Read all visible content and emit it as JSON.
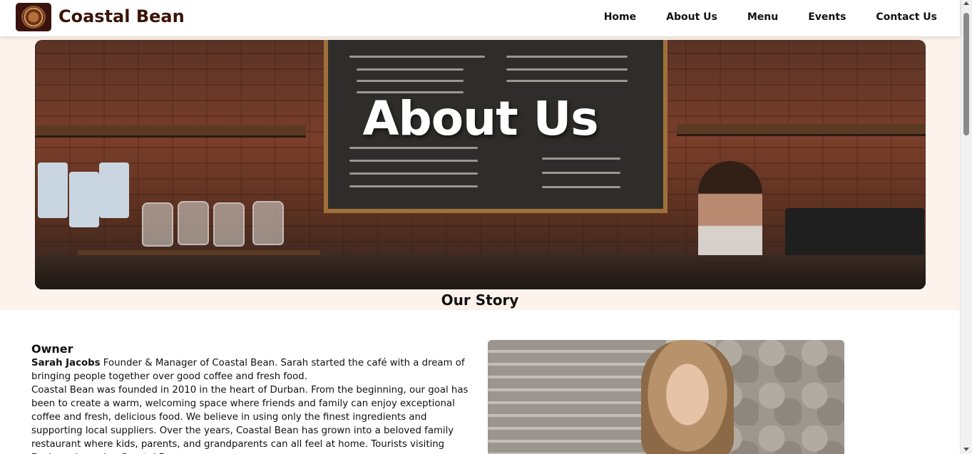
{
  "header": {
    "brand": "Coastal Bean",
    "logo_icon": "coffee-bean-logo-icon",
    "nav": [
      "Home",
      "About Us",
      "Menu",
      "Events",
      "Contact Us"
    ]
  },
  "hero": {
    "title": "About Us"
  },
  "story": {
    "title": "Our Story"
  },
  "owner": {
    "heading": "Owner",
    "name": "Sarah Jacobs",
    "intro": " Founder & Manager of Coastal Bean. Sarah started the café with a dream of bringing people together over good coffee and fresh food.",
    "paragraph": "Coastal Bean was founded in 2010 in the heart of Durban. From the beginning, our goal has been to create a warm, welcoming space where friends and family can enjoy exceptional coffee and fresh, delicious food. We believe in using only the finest ingredients and supporting local suppliers. Over the years, Coastal Bean has grown into a beloved family restaurant where kids, parents, and grandparents can all feel at home. Tourists visiting Durban also enjoy Coastal Bean"
  },
  "colors": {
    "brand": "#3a1408",
    "hero_band": "#fdf3ec"
  }
}
